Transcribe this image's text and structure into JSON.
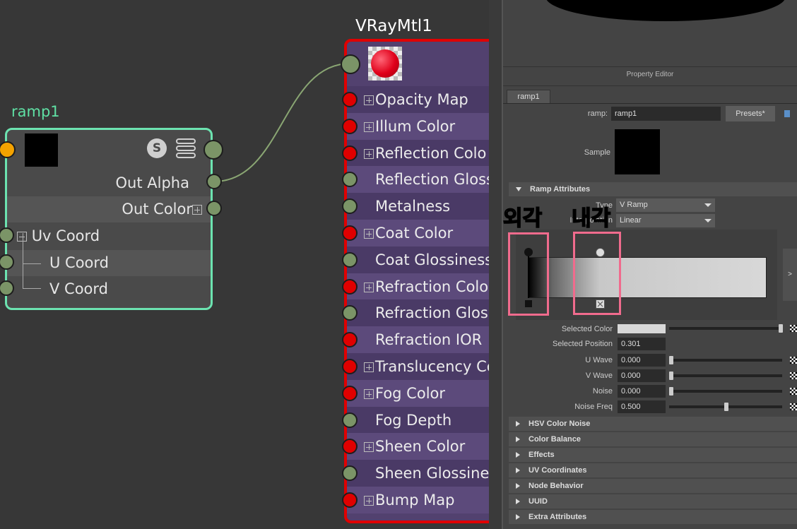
{
  "ramp_node": {
    "title": "ramp1",
    "badge": "S",
    "outputs": [
      "Out Alpha",
      "Out Color"
    ],
    "inputs": [
      "Uv Coord",
      "U Coord",
      "V Coord"
    ]
  },
  "vray_node": {
    "title": "VRayMtl1",
    "rows": [
      "Opacity Map",
      "Illum Color",
      "Reflection Colo",
      "Reflection Gloss",
      "Metalness",
      "Coat Color",
      "Coat Glossiness",
      "Refraction Colo",
      "Refraction Glos",
      "Refraction IOR",
      "Translucency Co",
      "Fog Color",
      "Fog Depth",
      "Sheen Color",
      "Sheen Glossines",
      "Bump Map"
    ]
  },
  "property_editor": {
    "title": "Property Editor",
    "tab": "ramp1",
    "node_label": "ramp:",
    "node_value": "ramp1",
    "presets_label": "Presets*",
    "sample_label": "Sample",
    "ramp_section": "Ramp Attributes",
    "type_label": "Type",
    "type_value": "V Ramp",
    "interp_label": "Interpolation",
    "interp_value": "Linear",
    "annotation_outer": "외각",
    "annotation_inner": "내각",
    "expand_label": ">",
    "selected_color_label": "Selected Color",
    "selected_position_label": "Selected Position",
    "selected_position_value": "0.301",
    "u_wave_label": "U Wave",
    "u_wave_value": "0.000",
    "v_wave_label": "V Wave",
    "v_wave_value": "0.000",
    "noise_label": "Noise",
    "noise_value": "0.000",
    "noise_freq_label": "Noise Freq",
    "noise_freq_value": "0.500",
    "sections": [
      "HSV Color Noise",
      "Color Balance",
      "Effects",
      "UV Coordinates",
      "Node Behavior",
      "UUID",
      "Extra Attributes"
    ]
  }
}
